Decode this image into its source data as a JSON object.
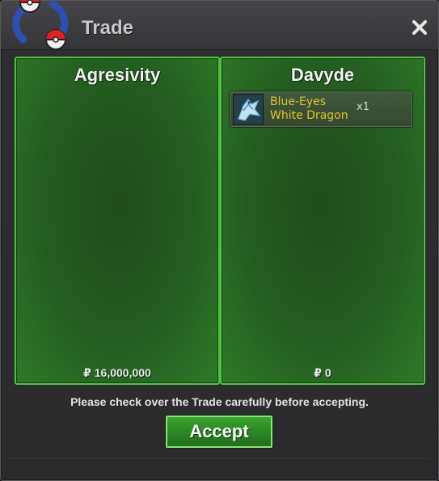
{
  "window": {
    "title": "Trade"
  },
  "left_panel": {
    "player_name": "Agresivity",
    "money": "₽ 16,000,000"
  },
  "right_panel": {
    "player_name": "Davyde",
    "money": "₽ 0",
    "items": [
      {
        "name_line1": "Blue-Eyes",
        "name_line2": "White Dragon",
        "quantity": "x1",
        "icon": "blue-eyes-white-dragon-icon"
      }
    ]
  },
  "footer": {
    "notice": "Please check over the Trade carefully before accepting.",
    "accept_label": "Accept"
  },
  "colors": {
    "panel_border": "#4ec440",
    "item_name": "#e5c22c",
    "accept_bg": "#2c8a24"
  }
}
